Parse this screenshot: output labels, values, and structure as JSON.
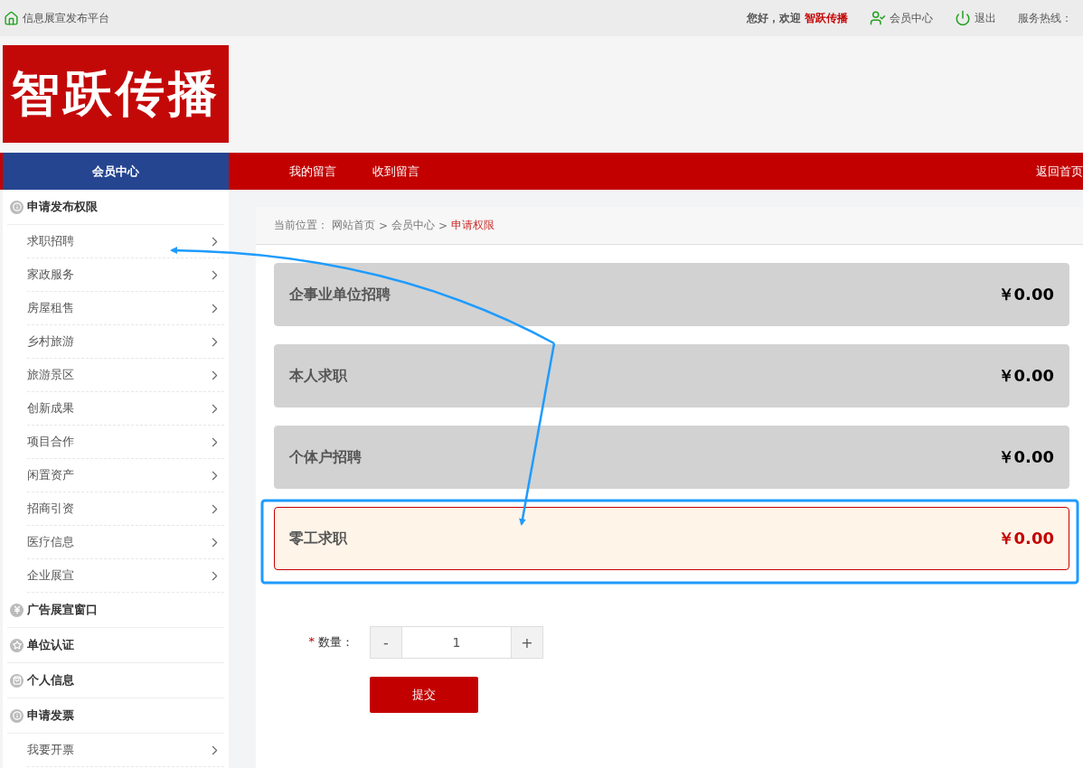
{
  "topbar": {
    "site_name": "信息展宣发布平台",
    "greeting": "您好，欢迎",
    "user": "智跃传播",
    "links": [
      {
        "kind": "member",
        "label": "会员中心"
      },
      {
        "kind": "logout",
        "label": "退出"
      }
    ],
    "hotline": "服务热线："
  },
  "logo": {
    "text": "智跃传播"
  },
  "nav": {
    "member_center": "会员中心",
    "items": [
      {
        "label": "我的留言"
      },
      {
        "label": "收到留言"
      }
    ],
    "home": "返回首页"
  },
  "sidebar": [
    {
      "kind": "info",
      "title": "申请发布权限",
      "items": [
        "求职招聘",
        "家政服务",
        "房屋租售",
        "乡村旅游",
        "旅游景区",
        "创新成果",
        "项目合作",
        "闲置资产",
        "招商引资",
        "医疗信息",
        "企业展宣"
      ]
    },
    {
      "kind": "yen",
      "title": "广告展宣窗口"
    },
    {
      "kind": "star",
      "title": "单位认证"
    },
    {
      "kind": "bag",
      "title": "个人信息"
    },
    {
      "kind": "info",
      "title": "申请发票",
      "items": [
        "我要开票"
      ]
    }
  ],
  "breadcrumb": [
    {
      "kind": "label",
      "text": "当前位置："
    },
    {
      "kind": "link",
      "text": "网站首页"
    },
    {
      "kind": "sep",
      "text": ">"
    },
    {
      "kind": "link",
      "text": "会员中心"
    },
    {
      "kind": "sep",
      "text": ">"
    },
    {
      "kind": "current",
      "text": "申请权限"
    }
  ],
  "plans": [
    {
      "name": "企事业单位招聘",
      "price": "￥0.00",
      "selected": false
    },
    {
      "name": "本人求职",
      "price": "￥0.00",
      "selected": false
    },
    {
      "name": "个体户招聘",
      "price": "￥0.00",
      "selected": false
    },
    {
      "name": "零工求职",
      "price": "￥0.00",
      "selected": true
    }
  ],
  "quantity": {
    "required": true,
    "required_mark": "*",
    "label": "数量：",
    "minus": "-",
    "value": "1",
    "plus": "+"
  },
  "submit": "提交"
}
